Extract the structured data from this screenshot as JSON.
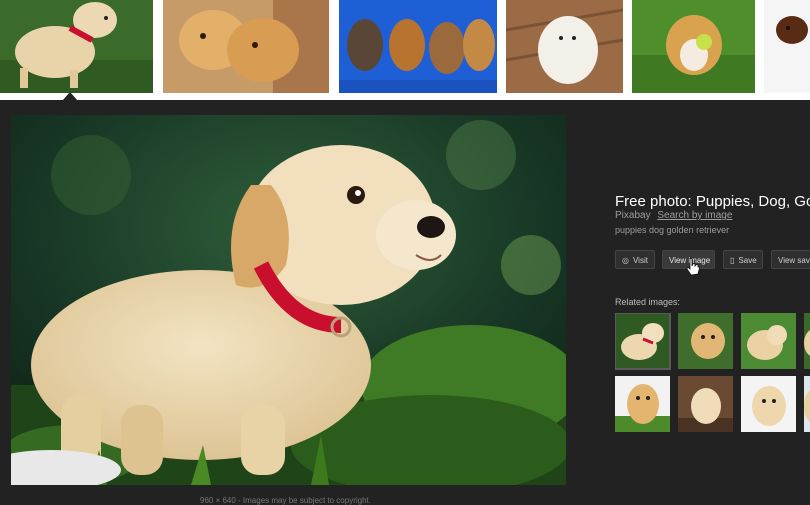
{
  "thumbnails": [
    {
      "name": "puppy-red-collar"
    },
    {
      "name": "two-golden-puppies"
    },
    {
      "name": "four-puppies-blue"
    },
    {
      "name": "white-puppy-deck"
    },
    {
      "name": "corgi-ball"
    },
    {
      "name": "dark-puppy"
    }
  ],
  "preview": {
    "title": "Free photo: Puppies, Dog, Golden",
    "source": "Pixabay",
    "search_by_image": "Search by image",
    "description": "puppies dog golden retriever",
    "caption": "960 × 640 - Images may be subject to copyright.",
    "buttons": {
      "visit": "Visit",
      "view_image": "View image",
      "save": "Save",
      "view_saved": "View saved"
    },
    "related_label": "Related images:",
    "related_count": 10
  },
  "colors": {
    "panel_bg": "#222222",
    "button_bg": "#2f2f2f",
    "title": "#ffffff"
  }
}
